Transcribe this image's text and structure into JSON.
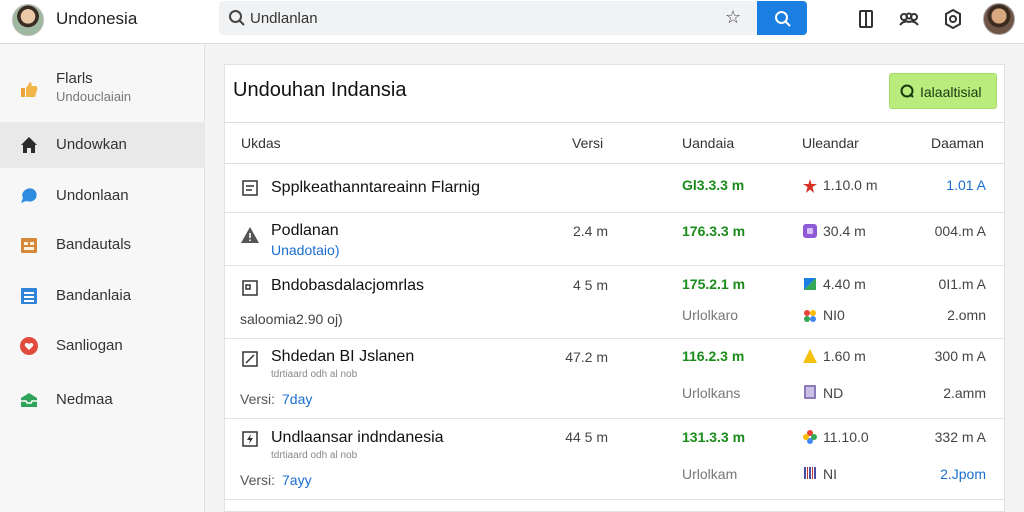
{
  "app": {
    "title": "Undonesia"
  },
  "search": {
    "value": "Undlanlan",
    "placeholder": "Undlanlan"
  },
  "sidebar": {
    "items": [
      {
        "label": "Flarls",
        "sub": "Undouclaiain"
      },
      {
        "label": "Undowkan"
      },
      {
        "label": "Undonlaan"
      },
      {
        "label": "Bandautals"
      },
      {
        "label": "Bandanlaia"
      },
      {
        "label": "Sanliogan"
      },
      {
        "label": "Nedmaa"
      }
    ]
  },
  "main": {
    "title": "Undouhan Indansia",
    "action_button": "Ialaaltisial",
    "columns": [
      "Ukdas",
      "Versi",
      "Uandaia",
      "Uleandar",
      "Daaman"
    ],
    "rows": [
      {
        "name": "Spplkeathanntareainn Flarnig",
        "size": "",
        "version": "Gl3.3.3 m",
        "developer": "1.10.0 m",
        "date": "1.01 A"
      },
      {
        "name": "Podlanan",
        "sub": "Unadotaio)",
        "size": "2.4 m",
        "version": "176.3.3 m",
        "developer": "30.4 m",
        "date": "004.m A"
      },
      {
        "name": "Bndobasdalacjomrlas",
        "sub": "saloomia2.90 oj)",
        "size": "4 5 m",
        "version": "175.2.1 m",
        "status": "Urlolkaro",
        "developer": "4.40 m",
        "developer2": "NI0",
        "date": "0I1.m A",
        "date2": "2.omn"
      },
      {
        "name": "Shdedan BI Jslanen",
        "sub": "tdrtiaard odh al nob",
        "extra_label": "Versi:",
        "extra_value": "7day",
        "size": "47.2 m",
        "version": "116.2.3 m",
        "status": "Urlolkans",
        "developer": "1.60 m",
        "developer2": "ND",
        "date": "300 m A",
        "date2": "2.amm"
      },
      {
        "name": "Undlaansar indndanesia",
        "sub": "tdrtiaard odh al nob",
        "extra_label": "Versi:",
        "extra_value": "7ayy",
        "size": "44 5 m",
        "version": "131.3.3 m",
        "status": "Urlolkam",
        "developer": "11.10.0",
        "developer2": "NI",
        "date": "332 m A",
        "date2": "2.Jpom"
      }
    ]
  },
  "colors": {
    "accent": "#1a7fe0",
    "green_text": "#1a8c1a",
    "primary_button": "#b9ec7d",
    "link_blue": "#1a6fd1"
  }
}
